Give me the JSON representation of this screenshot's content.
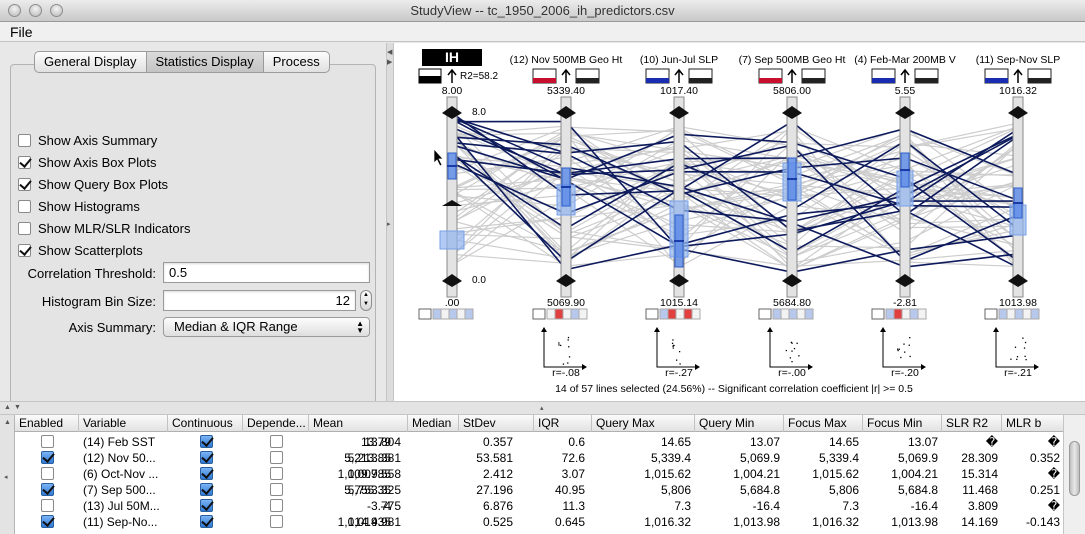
{
  "window": {
    "title": "StudyView -- tc_1950_2006_ih_predictors.csv"
  },
  "menu": {
    "file": "File"
  },
  "tabs": [
    "General Display",
    "Statistics Display",
    "Process"
  ],
  "options": {
    "show_axis_summary": {
      "label": "Show Axis Summary",
      "checked": false
    },
    "show_axis_box_plots": {
      "label": "Show Axis Box Plots",
      "checked": true
    },
    "show_query_box_plots": {
      "label": "Show Query Box Plots",
      "checked": true
    },
    "show_histograms": {
      "label": "Show Histograms",
      "checked": false
    },
    "show_mlr_slr": {
      "label": "Show MLR/SLR Indicators",
      "checked": false
    },
    "show_scatterplots": {
      "label": "Show Scatterplots",
      "checked": true
    },
    "correlation_threshold": {
      "label": "Correlation Threshold:",
      "value": "0.5"
    },
    "histogram_bin_size": {
      "label": "Histogram Bin Size:",
      "value": "12"
    },
    "axis_summary": {
      "label": "Axis Summary:",
      "value": "Median & IQR Range"
    }
  },
  "viz": {
    "r2_label": "R2=58.2",
    "inner_max_label": "8.0",
    "inner_min_label": "0.0",
    "status": "14 of 57 lines selected (24.56%)  --  Significant correlation coefficient  |r| >= 0.5",
    "colors": {
      "selected_line": "#0d1a5c",
      "context_line": "#cdcdcd",
      "box": "#8fb3f0",
      "positive": "#c8102e",
      "negative": "#1a2db0"
    },
    "axes": [
      {
        "title": "IH",
        "max": "8.00",
        "min": ".00",
        "r": "",
        "swatch": "black"
      },
      {
        "title": "(12) Nov 500MB Geo Ht",
        "max": "5339.40",
        "min": "5069.90",
        "r": "r=-.08",
        "swatch": "red"
      },
      {
        "title": "(10) Jun-Jul SLP",
        "max": "1017.40",
        "min": "1015.14",
        "r": "r=-.27",
        "swatch": "blue"
      },
      {
        "title": "(7) Sep 500MB Geo Ht",
        "max": "5806.00",
        "min": "5684.80",
        "r": "r=-.00",
        "swatch": "red"
      },
      {
        "title": "(4) Feb-Mar 200MB V",
        "max": "5.55",
        "min": "-2.81",
        "r": "r=-.20",
        "swatch": "blue"
      },
      {
        "title": "(11) Sep-Nov SLP",
        "max": "1016.32",
        "min": "1013.98",
        "r": "r=-.21",
        "swatch": "blue"
      }
    ]
  },
  "table": {
    "columns": [
      "Enabled",
      "Variable",
      "Continuous",
      "Depende...",
      "Mean",
      "Median",
      "StDev",
      "IQR",
      "Query Max",
      "Query Min",
      "Focus Max",
      "Focus Min",
      "SLR R2",
      "MLR b"
    ],
    "rows": [
      {
        "enabled": false,
        "variable": "(14) Feb SST",
        "continuous": true,
        "dependent": false,
        "mean": "13.804",
        "median": "13.79",
        "stdev": "0.357",
        "iqr": "0.6",
        "qmax": "14.65",
        "qmin": "13.07",
        "fmax": "14.65",
        "fmin": "13.07",
        "slr": "�",
        "mlr": "�"
      },
      {
        "enabled": true,
        "variable": "(12) Nov 50...",
        "continuous": true,
        "dependent": false,
        "mean": "5,213.381",
        "median": "5,213.85",
        "stdev": "53.581",
        "iqr": "72.6",
        "qmax": "5,339.4",
        "qmin": "5,069.9",
        "fmax": "5,339.4",
        "fmin": "5,069.9",
        "slr": "28.309",
        "mlr": "0.352"
      },
      {
        "enabled": false,
        "variable": "(6) Oct-Nov ...",
        "continuous": true,
        "dependent": false,
        "mean": "1,009.558",
        "median": "1,009.785",
        "stdev": "2.412",
        "iqr": "3.07",
        "qmax": "1,015.62",
        "qmin": "1,004.21",
        "fmax": "1,015.62",
        "fmin": "1,004.21",
        "slr": "15.314",
        "mlr": "�"
      },
      {
        "enabled": true,
        "variable": "(7) Sep 500...",
        "continuous": true,
        "dependent": false,
        "mean": "5,753.325",
        "median": "5,755.35",
        "stdev": "27.196",
        "iqr": "40.95",
        "qmax": "5,806",
        "qmin": "5,684.8",
        "fmax": "5,806",
        "fmin": "5,684.8",
        "slr": "11.468",
        "mlr": "0.251"
      },
      {
        "enabled": false,
        "variable": "(13) Jul 50M...",
        "continuous": true,
        "dependent": false,
        "mean": "-3.775",
        "median": "-4",
        "stdev": "6.876",
        "iqr": "11.3",
        "qmax": "7.3",
        "qmin": "-16.4",
        "fmax": "7.3",
        "fmin": "-16.4",
        "slr": "3.809",
        "mlr": "�"
      },
      {
        "enabled": true,
        "variable": "(11) Sep-No...",
        "continuous": true,
        "dependent": false,
        "mean": "1,014.981",
        "median": "1,014.935",
        "stdev": "0.525",
        "iqr": "0.645",
        "qmax": "1,016.32",
        "qmin": "1,013.98",
        "fmax": "1,016.32",
        "fmin": "1,013.98",
        "slr": "14.169",
        "mlr": "-0.143"
      }
    ]
  }
}
